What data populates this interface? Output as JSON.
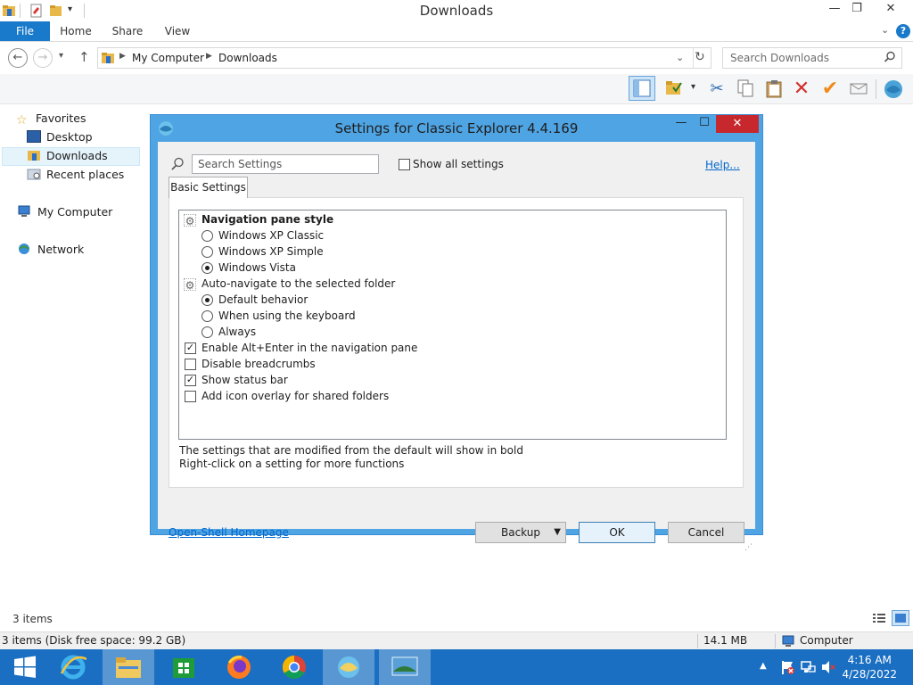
{
  "window": {
    "title": "Downloads"
  },
  "ribbon": {
    "tabs": [
      "File",
      "Home",
      "Share",
      "View"
    ],
    "help": "?"
  },
  "address": {
    "crumbs": [
      "My Computer",
      "Downloads"
    ]
  },
  "search": {
    "placeholder": "Search Downloads"
  },
  "nav": {
    "favorites": "Favorites",
    "desktop": "Desktop",
    "downloads": "Downloads",
    "recent": "Recent places",
    "computer": "My Computer",
    "network": "Network"
  },
  "status": {
    "items": "3 items",
    "disk": "3 items (Disk free space: 99.2 GB)",
    "size": "14.1 MB",
    "location": "Computer"
  },
  "taskbar": {
    "time": "4:16 AM",
    "date": "4/28/2022"
  },
  "dialog": {
    "title": "Settings for Classic Explorer 4.4.169",
    "search_placeholder": "Search Settings",
    "show_all": "Show all settings",
    "help": "Help...",
    "tab": "Basic Settings",
    "settings": {
      "nav_style": "Navigation pane style",
      "xp_classic": "Windows XP Classic",
      "xp_simple": "Windows XP Simple",
      "vista": "Windows Vista",
      "auto_nav": "Auto-navigate to the selected folder",
      "default": "Default behavior",
      "keyboard": "When using the keyboard",
      "always": "Always",
      "alt_enter": "Enable Alt+Enter in the navigation pane",
      "breadcrumbs": "Disable breadcrumbs",
      "status_bar": "Show status bar",
      "icon_overlay": "Add icon overlay for shared folders"
    },
    "footer1": "The settings that are modified from the default will show in bold",
    "footer2": "Right-click on a setting for more functions",
    "homepage": "Open-Shell Homepage",
    "backup": "Backup",
    "ok": "OK",
    "cancel": "Cancel"
  }
}
